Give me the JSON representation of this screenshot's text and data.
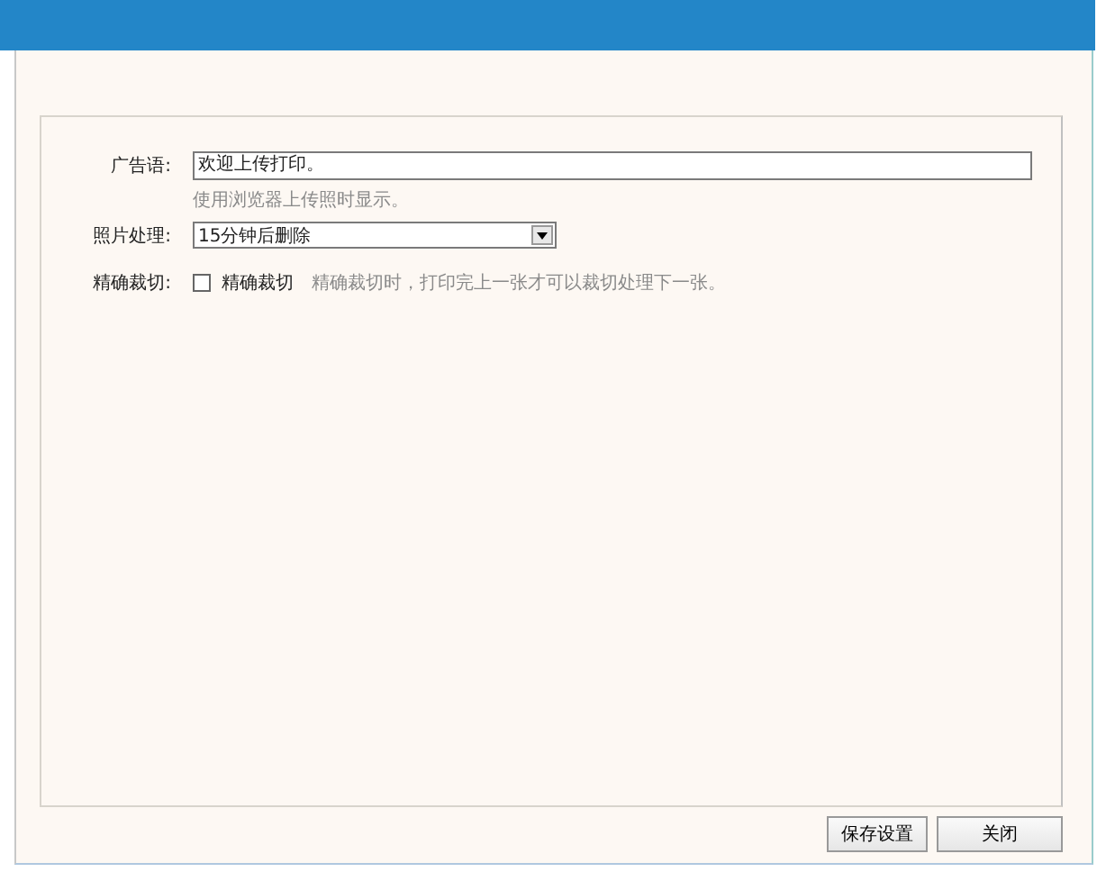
{
  "form": {
    "fields": [
      {
        "kind": "text",
        "label": "广告语:",
        "value": "欢迎上传打印。",
        "hint": "使用浏览器上传照时显示。"
      },
      {
        "kind": "select",
        "label": "照片处理:",
        "value": "15分钟后删除"
      },
      {
        "kind": "checkbox",
        "label": "精确裁切:",
        "option": "精确裁切",
        "checked": false,
        "hint": "精确裁切时，打印完上一张才可以裁切处理下一张。"
      }
    ]
  },
  "buttons": [
    "保存设置",
    "关闭"
  ]
}
